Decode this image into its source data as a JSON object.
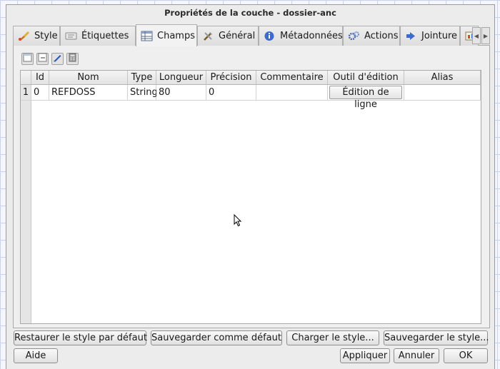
{
  "window": {
    "title": "Propriétés de la couche - dossier-anc"
  },
  "tabs": [
    {
      "label": "Style",
      "icon": "brush-icon"
    },
    {
      "label": "Étiquettes",
      "icon": "label-icon"
    },
    {
      "label": "Champs",
      "icon": "table-icon",
      "active": true
    },
    {
      "label": "Général",
      "icon": "tools-icon"
    },
    {
      "label": "Métadonnées",
      "icon": "info-icon"
    },
    {
      "label": "Actions",
      "icon": "gears-icon"
    },
    {
      "label": "Jointure",
      "icon": "join-icon"
    }
  ],
  "toolbar": {
    "buttons": [
      "new-field-icon",
      "delete-field-icon",
      "edit-mode-icon",
      "calculator-icon"
    ]
  },
  "table": {
    "columns": [
      "Id",
      "Nom",
      "Type",
      "Longueur",
      "Précision",
      "Commentaire",
      "Outil d'édition",
      "Alias"
    ],
    "rows": [
      {
        "row_number": "1",
        "id": "0",
        "nom": "REFDOSS",
        "type": "String",
        "longueur": "80",
        "precision": "0",
        "commentaire": "",
        "outil": "Édition de ligne",
        "alias": ""
      }
    ]
  },
  "style_buttons": {
    "restore": "Restaurer le style par défaut",
    "save_default": "Sauvegarder comme défaut",
    "load": "Charger le style...",
    "save": "Sauvegarder le style..."
  },
  "footer": {
    "help": "Aide",
    "apply": "Appliquer",
    "cancel": "Annuler",
    "ok": "OK"
  }
}
